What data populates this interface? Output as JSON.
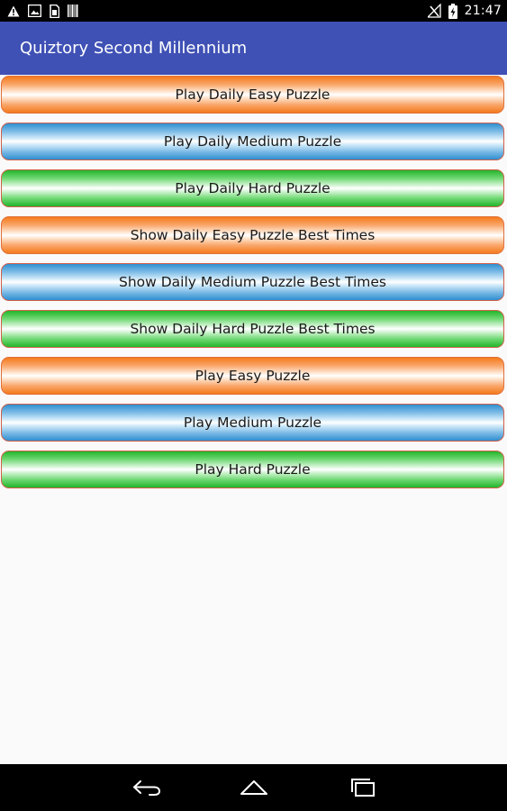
{
  "status_bar": {
    "time": "21:47",
    "left_icons": [
      "warning-icon",
      "photo-icon",
      "sim-card-icon",
      "barcode-icon"
    ],
    "right_icons": [
      "no-signal-icon",
      "battery-charging-icon"
    ]
  },
  "app_bar": {
    "title": "Quiztory Second Millennium",
    "color": "#3f51b5"
  },
  "buttons": [
    {
      "label": "Play Daily Easy Puzzle",
      "color": "orange"
    },
    {
      "label": "Play Daily Medium Puzzle",
      "color": "blue"
    },
    {
      "label": "Play Daily Hard Puzzle",
      "color": "green"
    },
    {
      "label": "Show Daily Easy Puzzle Best Times",
      "color": "orange"
    },
    {
      "label": "Show Daily Medium Puzzle Best Times",
      "color": "blue"
    },
    {
      "label": "Show Daily Hard Puzzle Best Times",
      "color": "green"
    },
    {
      "label": "Play Easy Puzzle",
      "color": "orange"
    },
    {
      "label": "Play Medium Puzzle",
      "color": "blue"
    },
    {
      "label": "Play Hard Puzzle",
      "color": "green"
    }
  ],
  "nav_bar": {
    "icons": [
      "back-icon",
      "home-icon",
      "recents-icon"
    ]
  }
}
